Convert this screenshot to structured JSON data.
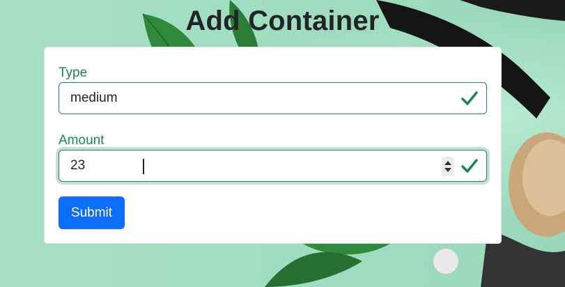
{
  "page": {
    "title": "Add Container"
  },
  "form": {
    "type": {
      "label": "Type",
      "value": "medium",
      "valid": true
    },
    "amount": {
      "label": "Amount",
      "value": "23",
      "valid": true
    },
    "submit_label": "Submit"
  },
  "colors": {
    "valid": "#198754",
    "primary": "#0d6efd",
    "background": "#9fdcbf"
  },
  "icons": {
    "valid": "check-icon",
    "number_spinner": "spinner-arrows-icon"
  }
}
